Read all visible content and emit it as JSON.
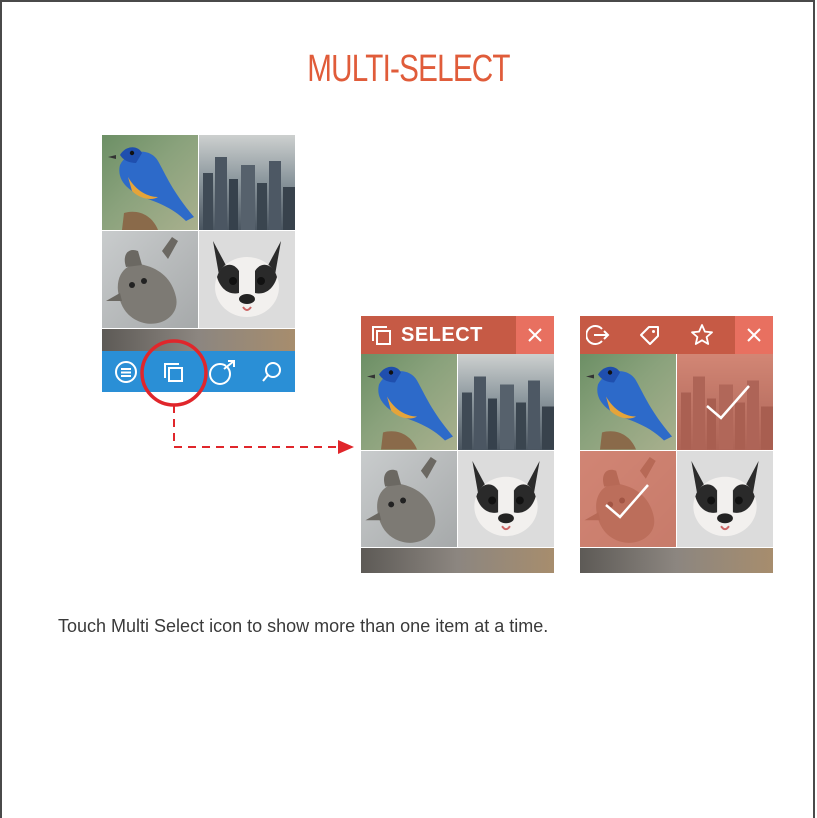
{
  "page": {
    "title": "MULTI-SELECT",
    "caption": "Touch Multi Select icon to show more than one item at a time."
  },
  "colors": {
    "accent": "#e05c3a",
    "bar_blue": "#2a8fd6",
    "select_bar": "#c65a45",
    "close_bg": "#e87060",
    "selected_overlay": "#d46a52",
    "highlight_circle": "#e0262b"
  },
  "phone1": {
    "tiles": [
      "bird-photo",
      "city-photo",
      "cat-photo",
      "dog-photo"
    ],
    "bottom_bar_icons": [
      "menu-icon",
      "multi-select-icon",
      "share-icon",
      "search-icon"
    ]
  },
  "phone2": {
    "header": {
      "select_label": "SELECT",
      "icons": [
        "multi-select-icon",
        "close-icon"
      ]
    },
    "tiles": [
      "bird-photo",
      "city-photo",
      "cat-photo",
      "dog-photo"
    ]
  },
  "phone3": {
    "header_icons": [
      "share-out-icon",
      "tag-icon",
      "star-icon",
      "close-icon"
    ],
    "tiles": [
      {
        "name": "bird-photo",
        "selected": false
      },
      {
        "name": "city-photo",
        "selected": true
      },
      {
        "name": "cat-photo",
        "selected": true
      },
      {
        "name": "dog-photo",
        "selected": false
      }
    ]
  }
}
